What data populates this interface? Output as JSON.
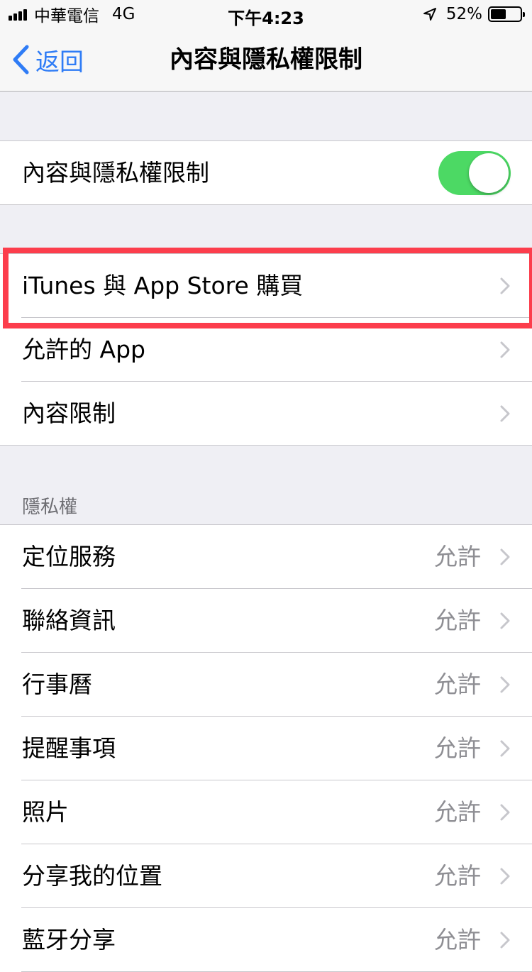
{
  "status_bar": {
    "carrier": "中華電信",
    "network": "4G",
    "time": "下午4:23",
    "battery_percent": "52%",
    "battery_level": 0.52
  },
  "nav": {
    "back_label": "返回",
    "title": "內容與隱私權限制"
  },
  "main_toggle": {
    "label": "內容與隱私權限制",
    "on": true
  },
  "store_section": {
    "items": [
      {
        "label": "iTunes 與 App Store 購買"
      },
      {
        "label": "允許的 App"
      },
      {
        "label": "內容限制"
      }
    ]
  },
  "privacy_section": {
    "header": "隱私權",
    "items": [
      {
        "label": "定位服務",
        "value": "允許"
      },
      {
        "label": "聯絡資訊",
        "value": "允許"
      },
      {
        "label": "行事曆",
        "value": "允許"
      },
      {
        "label": "提醒事項",
        "value": "允許"
      },
      {
        "label": "照片",
        "value": "允許"
      },
      {
        "label": "分享我的位置",
        "value": "允許"
      },
      {
        "label": "藍牙分享",
        "value": "允許"
      }
    ]
  },
  "colors": {
    "accent": "#2f7cf6",
    "toggle_on": "#4cd964",
    "highlight": "#fc3d4c",
    "background": "#efeff4"
  }
}
